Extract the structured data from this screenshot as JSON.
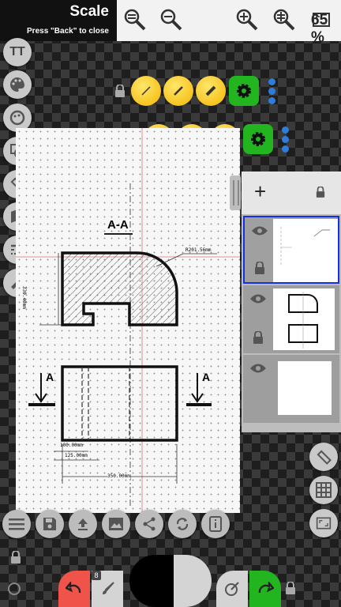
{
  "header": {
    "title": "Scale",
    "hint": "Press \"Back\" to close"
  },
  "zoom": {
    "value": "65",
    "unit": "%"
  },
  "drawing": {
    "section_label": "A-A",
    "arrow_left": "A",
    "arrow_right": "A",
    "dim_radius": "R201.56mm",
    "dim_height": "330.40mm",
    "dim_100": "100.00mm",
    "dim_125": "125.00mm",
    "dim_350": "350.00mm"
  },
  "layers": {
    "add_label": "+"
  },
  "brush": {
    "size_badge": "8"
  },
  "colors": {
    "accent_green": "#22b51f",
    "accent_yellow": "#f3b600",
    "undo_red": "#f0534a",
    "selection_blue": "#1530e0"
  }
}
